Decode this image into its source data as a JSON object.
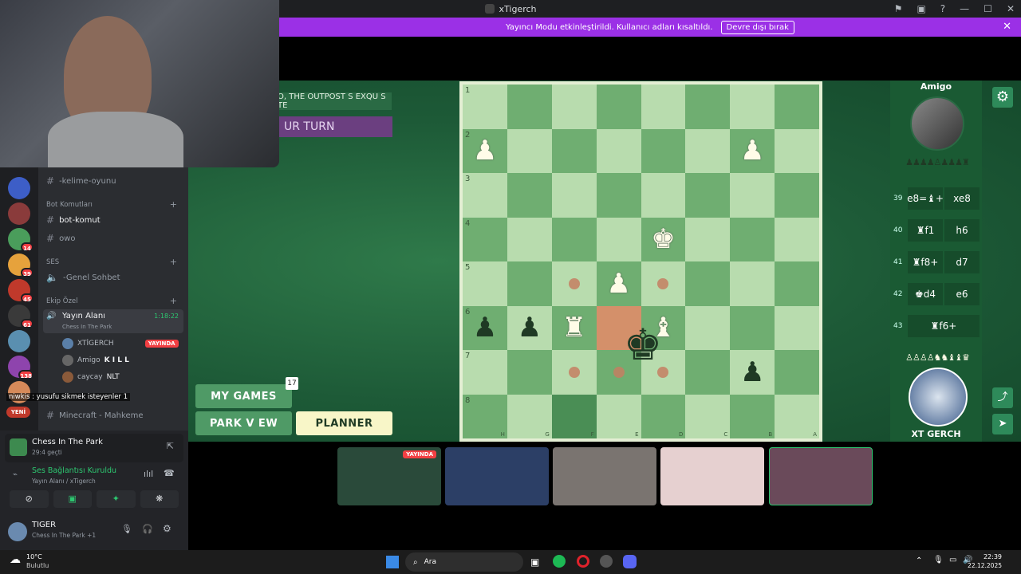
{
  "window": {
    "title": "xTigerch"
  },
  "banner": {
    "text": "Yayıncı Modu etkinleştirildi. Kullanıcı adları kısaltıldı.",
    "button": "Devre dışı bırak"
  },
  "channels": {
    "items": [
      {
        "name": "-kelime-oyunu"
      },
      {
        "name": "bot-komut"
      },
      {
        "name": "owo"
      },
      {
        "name": "-Genel Sohbet"
      },
      {
        "name": "Minecraft - Mahkeme"
      }
    ],
    "categories": [
      "Bot Komutları",
      "SES",
      "Ekip Özel"
    ],
    "voice_channel": {
      "name": "Yayın Alanı",
      "activity": "Chess In The Park",
      "timer": "1:18:22"
    },
    "voice_users": [
      {
        "name": "XTİGERCH",
        "badge": "YAYINDA"
      },
      {
        "name": "Amigo",
        "extra": "K I L L"
      },
      {
        "name": "caycay",
        "extra": "NLT"
      }
    ],
    "chat_overlay": "niwkis : yusufu sikmek isteyenler 1",
    "new_badge": "YENİ"
  },
  "servers": {
    "badges": [
      "14",
      "39",
      "45",
      "61",
      "138"
    ]
  },
  "voice_panel": {
    "activity_title": "Chess In The Park",
    "activity_time": "29:4 geçti",
    "connection_status": "Ses Bağlantısı Kuruldu",
    "connection_channel": "Yayın Alanı / xTigerch",
    "user_name": "TIGER",
    "user_status": "Chess In The Park +1"
  },
  "game": {
    "message": "O, THE OUTPOST S EXQU S TE",
    "turn": "UR TURN",
    "buttons": {
      "my_games": "MY GAMES",
      "my_games_badge": "17",
      "park_view": "PARK V EW",
      "planner": "PLANNER"
    },
    "opponent": "Amigo",
    "player": "XT GERCH",
    "ranks": [
      "1",
      "2",
      "3",
      "4",
      "5",
      "6",
      "7",
      "8"
    ],
    "files": [
      "H",
      "G",
      "F",
      "E",
      "D",
      "C",
      "B",
      "A"
    ],
    "moves": [
      {
        "num": "39",
        "white": "e8=♝+",
        "black": "xe8"
      },
      {
        "num": "40",
        "white": "♜f1",
        "black": "h6"
      },
      {
        "num": "41",
        "white": "♜f8+",
        "black": "d7"
      },
      {
        "num": "42",
        "white": "♚d4",
        "black": "e6"
      },
      {
        "num": "43",
        "white": "♜f6+",
        "black": ""
      }
    ]
  },
  "tiles": {
    "live_badge": "YAYINDA"
  },
  "taskbar": {
    "weather_temp": "10°C",
    "weather_desc": "Bulutlu",
    "search": "Ara",
    "time": "22:39",
    "date": "22.12.2025"
  }
}
